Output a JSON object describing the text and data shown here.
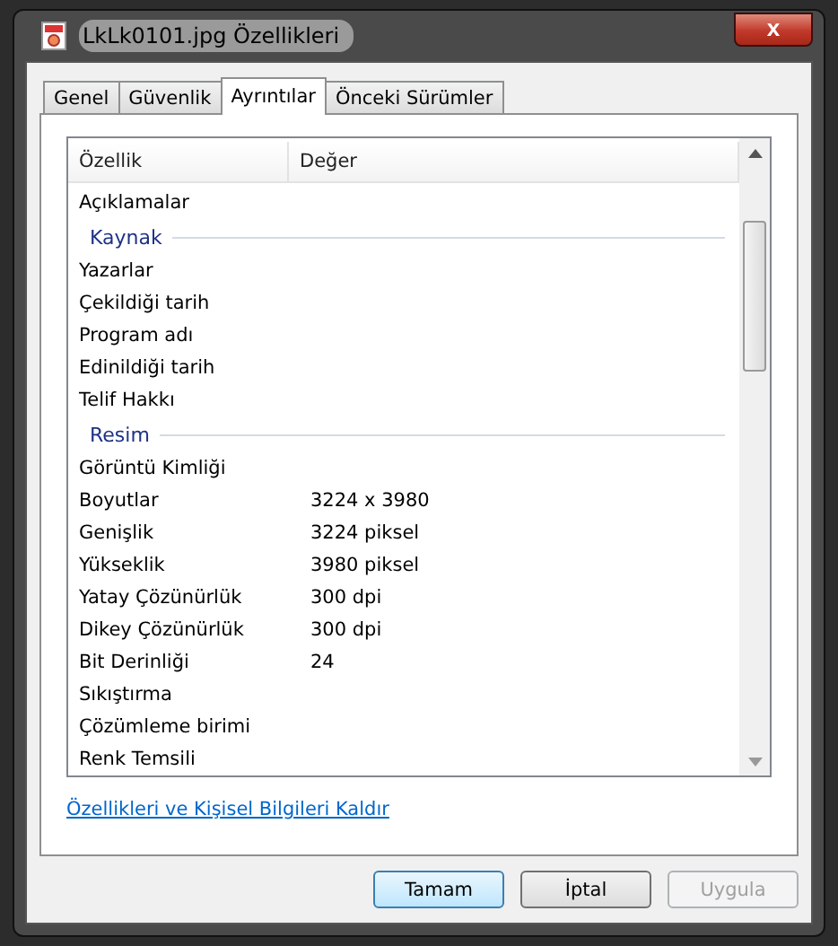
{
  "window": {
    "title": "LkLk0101.jpg Özellikleri",
    "close": "x"
  },
  "tabs": [
    {
      "label": "Genel",
      "selected": false
    },
    {
      "label": "Güvenlik",
      "selected": false
    },
    {
      "label": "Ayrıntılar",
      "selected": true
    },
    {
      "label": "Önceki Sürümler",
      "selected": false
    }
  ],
  "columns": [
    "Özellik",
    "Değer"
  ],
  "rows": [
    {
      "kind": "property",
      "name": "Açıklamalar"
    },
    {
      "kind": "section",
      "name": "Kaynak"
    },
    {
      "kind": "property",
      "name": "Yazarlar"
    },
    {
      "kind": "property",
      "name": "Çekildiği tarih"
    },
    {
      "kind": "property",
      "name": "Program adı"
    },
    {
      "kind": "property",
      "name": "Edinildiği tarih"
    },
    {
      "kind": "property",
      "name": "Telif Hakkı"
    },
    {
      "kind": "section",
      "name": "Resim"
    },
    {
      "kind": "property",
      "name": "Görüntü Kimliği"
    },
    {
      "kind": "property",
      "name": "Boyutlar",
      "value": "3224 x 3980"
    },
    {
      "kind": "property",
      "name": "Genişlik",
      "value": "3224 piksel"
    },
    {
      "kind": "property",
      "name": "Yükseklik",
      "value": "3980 piksel"
    },
    {
      "kind": "property",
      "name": "Yatay Çözünürlük",
      "value": "300 dpi"
    },
    {
      "kind": "property",
      "name": "Dikey Çözünürlük",
      "value": "300 dpi"
    },
    {
      "kind": "property",
      "name": "Bit Derinliği",
      "value": "24"
    },
    {
      "kind": "property",
      "name": "Sıkıştırma"
    },
    {
      "kind": "property",
      "name": "Çözümleme birimi"
    },
    {
      "kind": "property",
      "name": "Renk Temsili"
    }
  ],
  "link": "Özellikleri ve Kişisel Bilgileri Kaldır",
  "buttons": [
    {
      "label": "Tamam",
      "kind": "default",
      "disabled": false
    },
    {
      "label": "İptal",
      "kind": "normal",
      "disabled": false
    },
    {
      "label": "Uygula",
      "kind": "normal",
      "disabled": true
    }
  ]
}
